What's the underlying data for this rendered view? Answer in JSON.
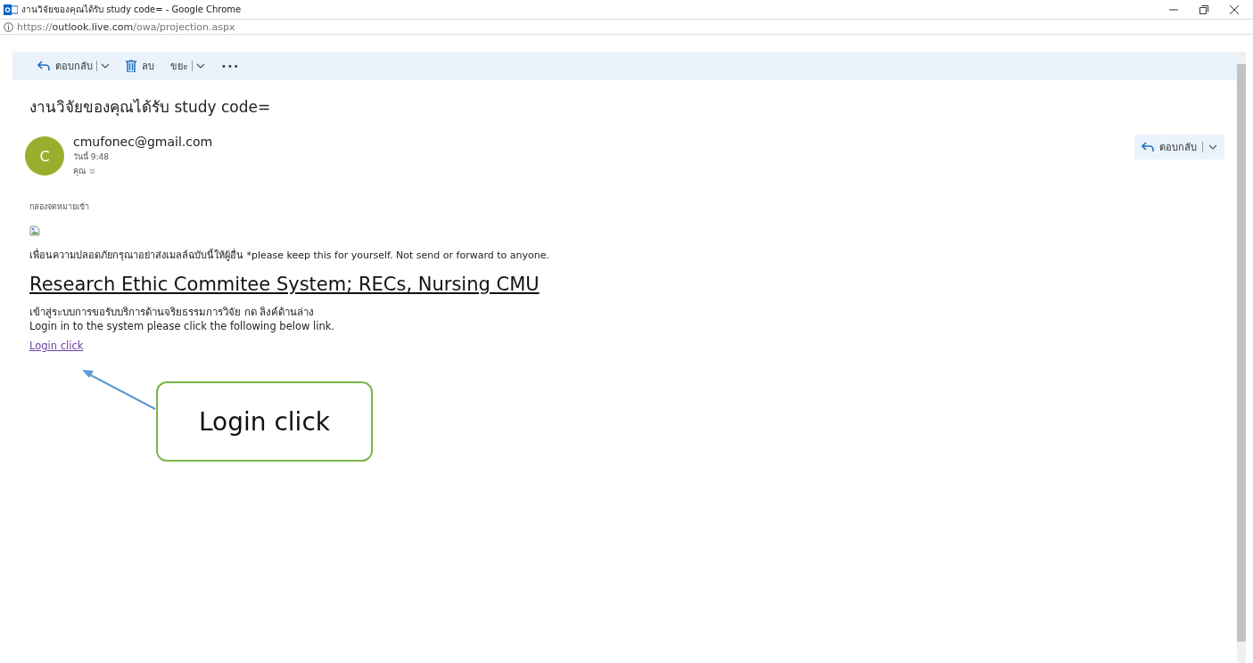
{
  "window": {
    "title": "งานวิจัยของคุณได้รับ study code= - Google Chrome",
    "url_prefix": "https://",
    "url_host": "outlook.live.com",
    "url_path": "/owa/projection.aspx"
  },
  "toolbar": [
    {
      "kind": "reply",
      "label": "ตอบกลับ"
    },
    {
      "kind": "delete",
      "label": "ลบ"
    },
    {
      "kind": "junk",
      "label": "ขยะ"
    },
    {
      "kind": "more",
      "label": "•••"
    }
  ],
  "message": {
    "subject": "งานวิจัยของคุณได้รับ study code=",
    "avatar_letter": "C",
    "sender": "cmufonec@gmail.com",
    "time": "วันนี้ 9:48",
    "recipient": "คุณ",
    "reply_label": "ตอบกลับ",
    "folder": "กล่องจดหมายเข้า",
    "body": {
      "notice": "เพื่อนความปลอดภัยกรุณาอย่าส่งเมลล์ฉบับนี้ให้ผู้อื่น *please keep this for yourself. Not send or forward to anyone.",
      "heading": "Research Ethic Commitee System; RECs, Nursing CMU",
      "line_thai": "เข้าสู่ระบบการขอรับบริการด้านจริยธรรมการวิจัย กด ลิงค์ด้านล่าง",
      "line_en": "Login in to the system please click the following below link.",
      "link": "Login click"
    }
  },
  "annotation": {
    "text": "Login click"
  }
}
